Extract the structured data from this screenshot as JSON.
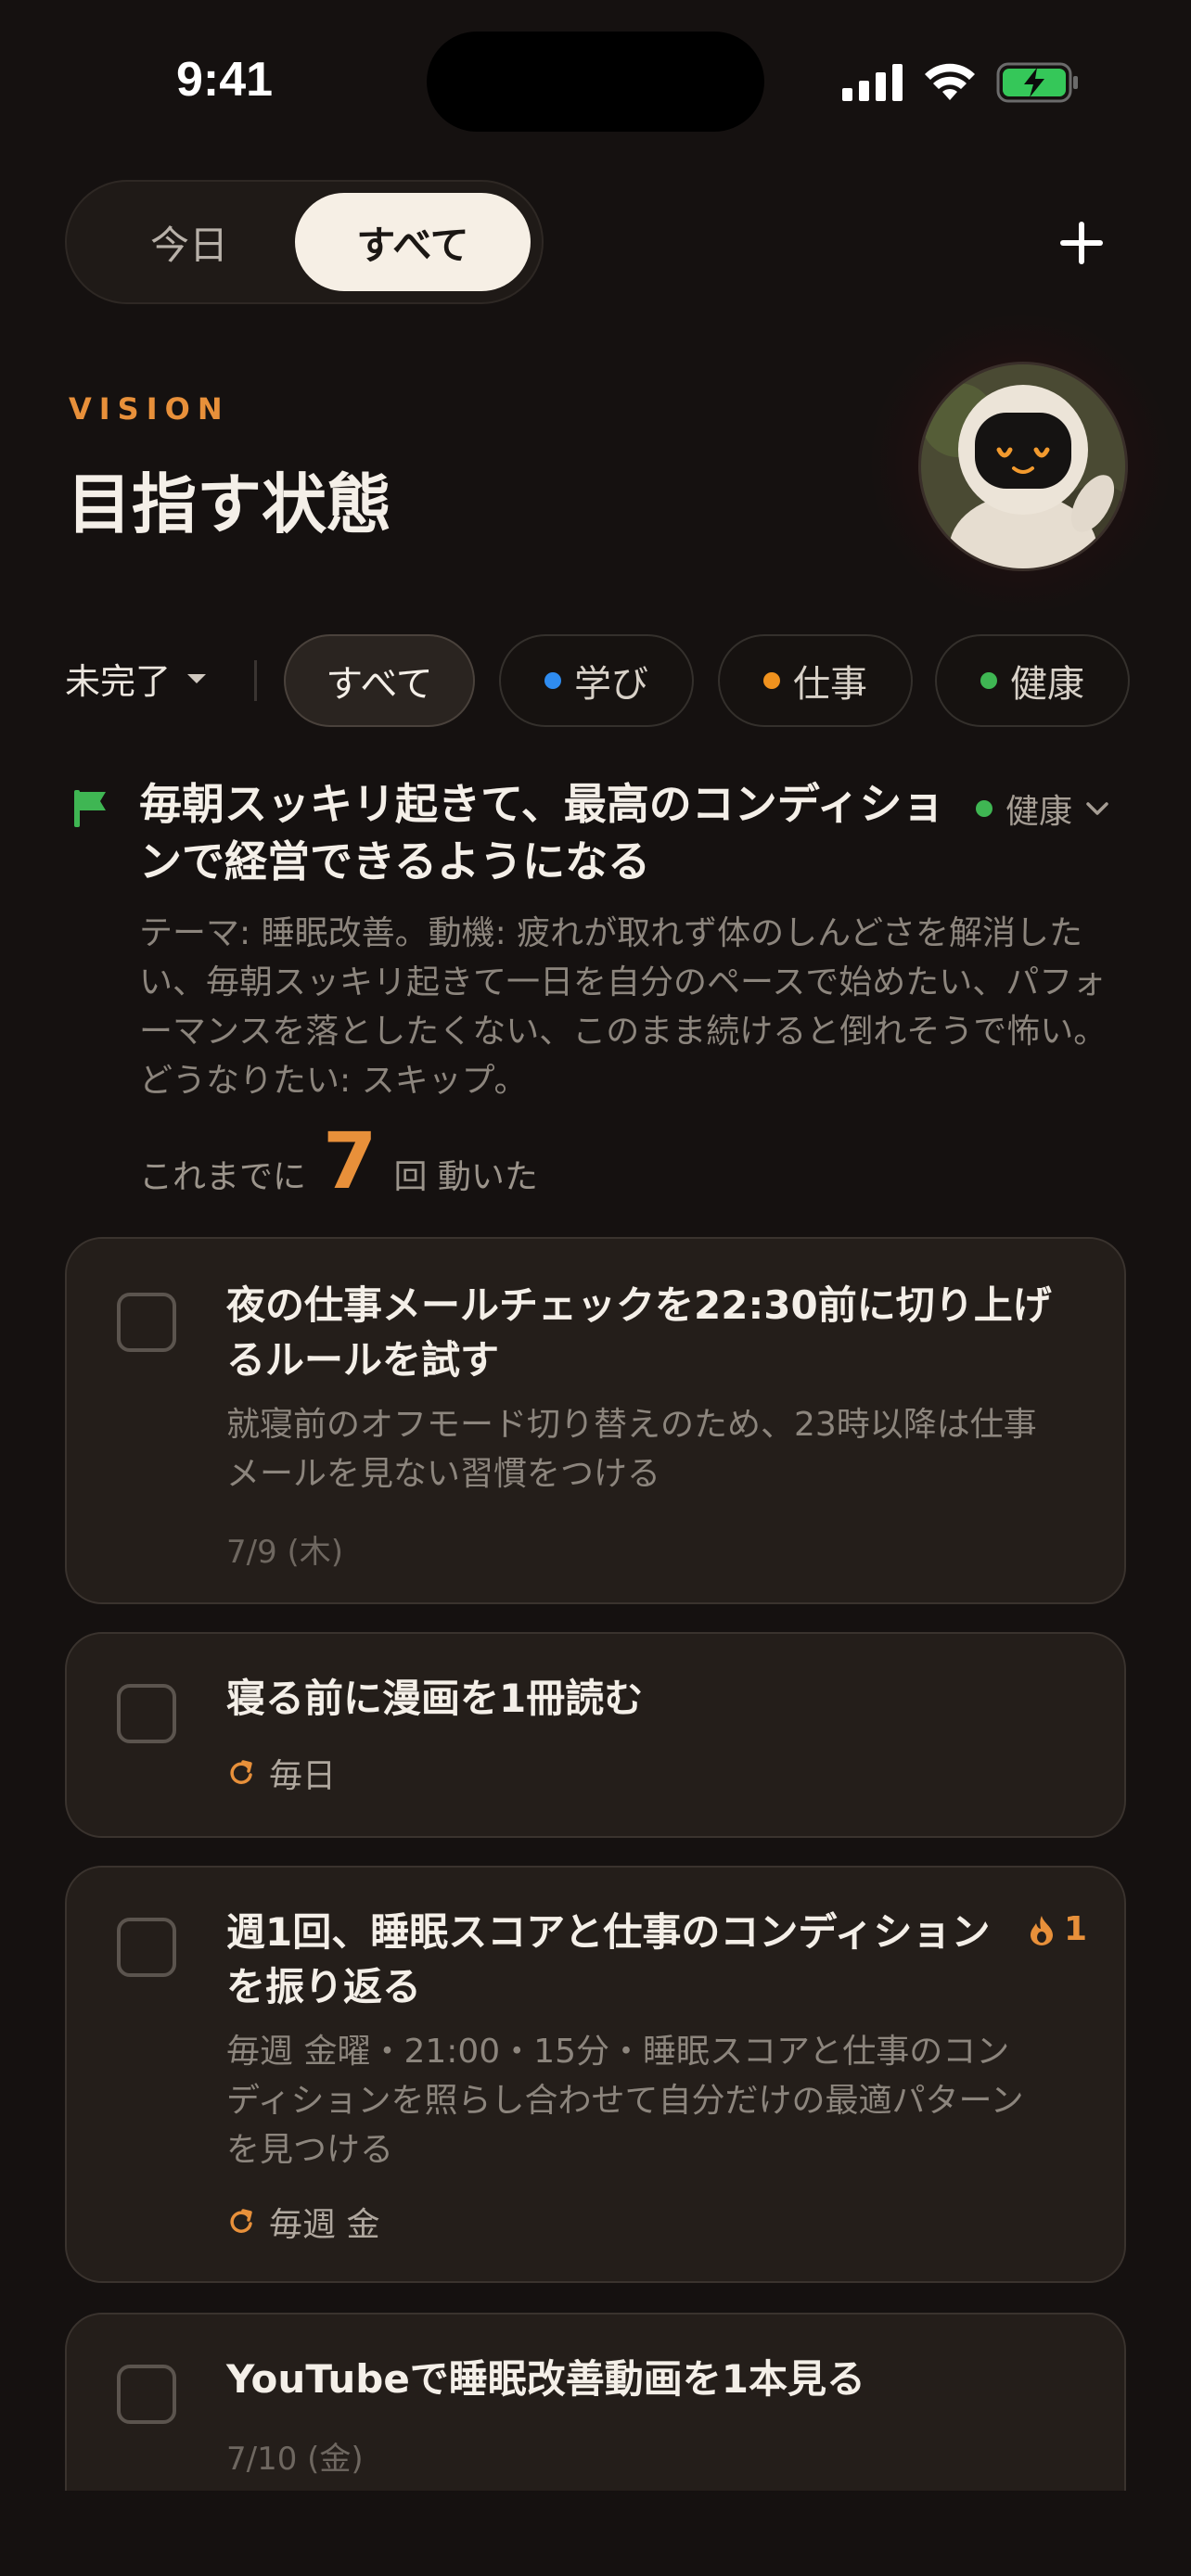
{
  "status_bar": {
    "time": "9:41"
  },
  "segment": {
    "today": "今日",
    "all": "すべて"
  },
  "add_label": "+",
  "vision": {
    "label": "VISION",
    "title": "目指す状態"
  },
  "filters": {
    "status": "未完了",
    "chips": [
      {
        "label": "すべて",
        "color": ""
      },
      {
        "label": "学び",
        "color": "#2f8cf0"
      },
      {
        "label": "仕事",
        "color": "#f0921e"
      },
      {
        "label": "健康",
        "color": "#3fb653"
      }
    ]
  },
  "goal": {
    "title": "毎朝スッキリ起きて、最高のコンディションで経営できるようになる",
    "category": "健康",
    "category_color": "#3fb653",
    "description": "テーマ: 睡眠改善。動機: 疲れが取れず体のしんどさを解消したい、毎朝スッキリ起きて一日を自分のペースで始めたい、パフォーマンスを落としたくない、このまま続けると倒れそうで怖い。どうなりたい: スキップ。",
    "count_prefix": "これまでに",
    "count": "7",
    "count_suffix": "回 動いた"
  },
  "tasks": [
    {
      "title": "夜の仕事メールチェックを22:30前に切り上げるルールを試す",
      "description": "就寝前のオフモード切り替えのため、23時以降は仕事メールを見ない習慣をつける",
      "date": "7/9 (木)"
    },
    {
      "title": "寝る前に漫画を1冊読む",
      "repeat": "毎日"
    },
    {
      "title": "週1回、睡眠スコアと仕事のコンディションを振り返る",
      "streak": "1",
      "description": "毎週 金曜・21:00・15分・睡眠スコアと仕事のコンディションを照らし合わせて自分だけの最適パターンを見つける",
      "repeat": "毎週 金"
    },
    {
      "title": "YouTubeで睡眠改善動画を1本見る",
      "date": "7/10 (金)"
    }
  ],
  "colors": {
    "accent": "#e8903a",
    "background": "#151110",
    "card": "#241e1a"
  }
}
